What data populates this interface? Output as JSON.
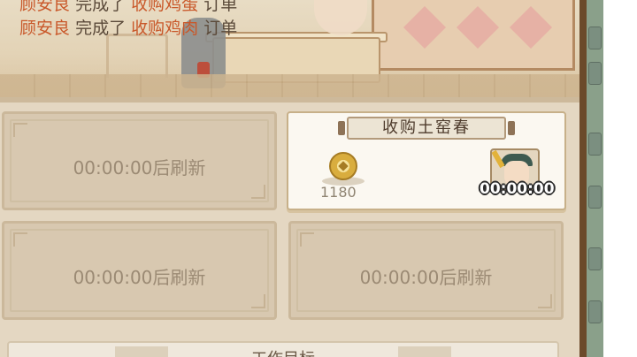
{
  "order_feed": [
    {
      "name": "顾安良",
      "verb": "完成了",
      "item": "收购鸡蛋",
      "tail": "订单"
    },
    {
      "name": "顾安良",
      "verb": "完成了",
      "item": "收购鸡肉",
      "tail": "订单"
    }
  ],
  "slots": [
    {
      "refresh_text": "00:00:00后刷新"
    },
    {
      "refresh_text": "00:00:00后刷新"
    },
    {
      "refresh_text": "00:00:00后刷新"
    }
  ],
  "active_order": {
    "title": "收购土窑春",
    "reward_amount": "1180",
    "reward_icon": "copper-coin-icon",
    "customer_icon": "customer-portrait",
    "timer": "00:00:00"
  },
  "bottom_tab": {
    "label": "工作目标"
  },
  "colors": {
    "name_highlight": "#c9582a",
    "feed_text": "#5b4a3a",
    "slot_bg": "#d8c8b0",
    "card_bg": "#fbf8f1"
  }
}
